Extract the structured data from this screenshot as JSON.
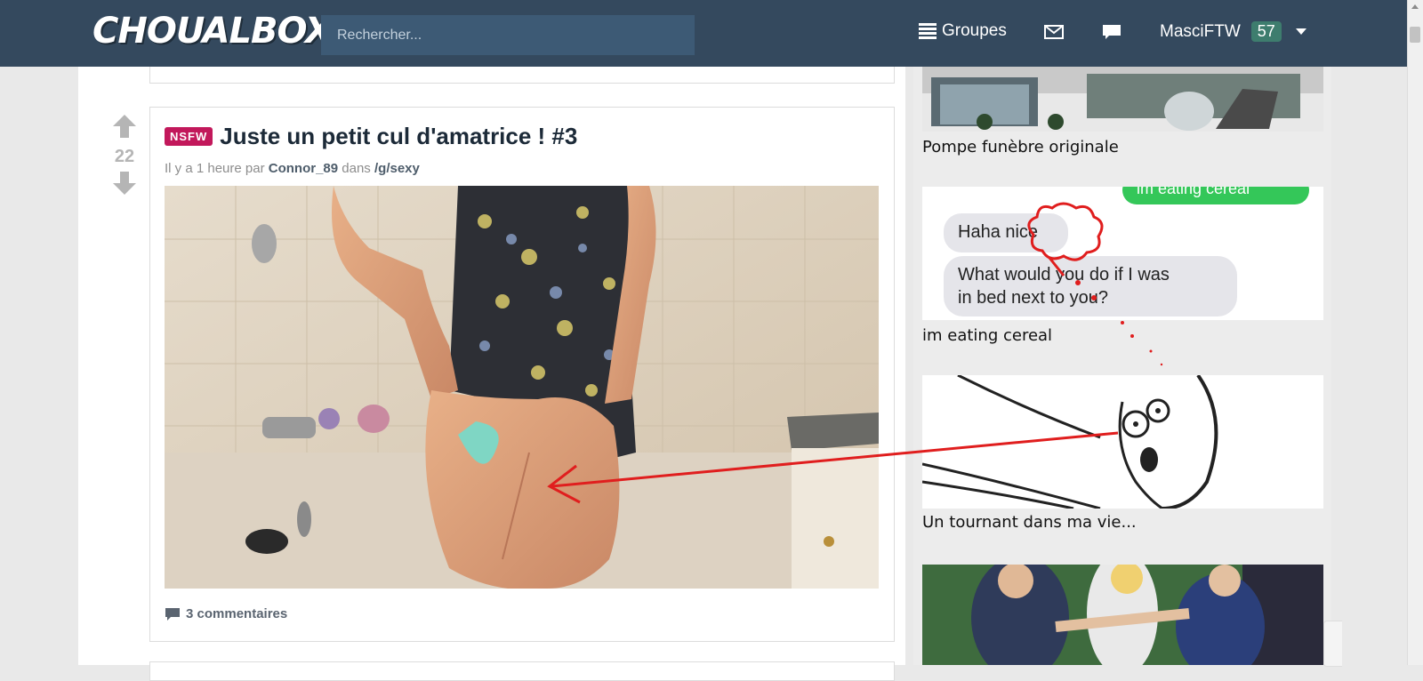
{
  "header": {
    "logo": "CHOUALBOX",
    "search_placeholder": "Rechercher...",
    "groups_label": "Groupes",
    "username": "MasciFTW",
    "points": "57"
  },
  "post": {
    "vote_count": "22",
    "nsfw_label": "NSFW",
    "title": "Juste un petit cul d'amatrice ! #3",
    "meta_prefix": "Il y a 1 heure par",
    "author": "Connor_89",
    "meta_in": "dans",
    "group": "/g/sexy",
    "comments_label": "3 commentaires"
  },
  "sidebar": {
    "items": [
      {
        "caption": "Pompe funèbre originale"
      },
      {
        "caption": "im eating cereal"
      },
      {
        "caption": "Un tournant dans ma vie..."
      }
    ],
    "chat": {
      "bubble_top": "im eating cereal",
      "bubble_one": "Haha nice",
      "bubble_two_line1": "What would you do if I was",
      "bubble_two_line2": "in bed next to you?"
    }
  }
}
